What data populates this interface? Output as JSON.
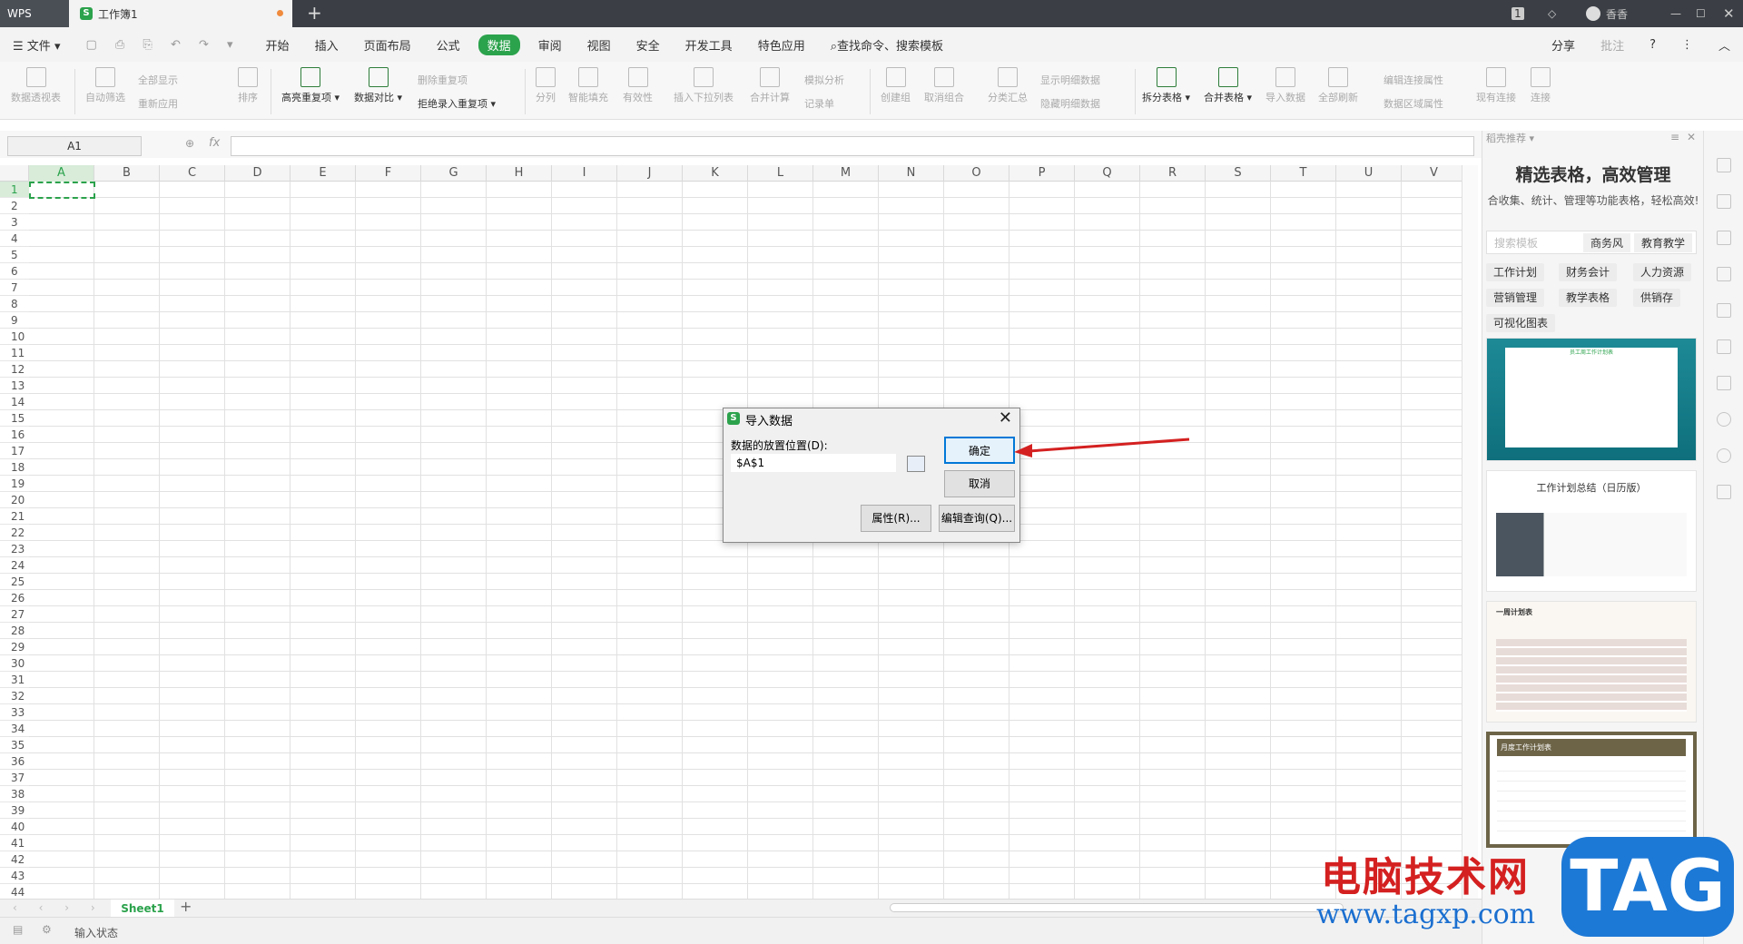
{
  "titlebar": {
    "wps_tab": "WPS",
    "doc_tab": "工作簿1",
    "new_tab": "+",
    "right_user": "香香",
    "right_badge": "1"
  },
  "menubar": {
    "file": "文件",
    "items": [
      "开始",
      "插入",
      "页面布局",
      "公式",
      "数据",
      "审阅",
      "视图",
      "安全",
      "开发工具",
      "特色应用"
    ],
    "active": "数据",
    "search": "查找命令、搜索模板",
    "share": "分享",
    "comment": "批注",
    "help": "?"
  },
  "toolbar": {
    "pivot": "数据透视表",
    "autofilter": "自动筛选",
    "show_all": "全部显示",
    "reapply": "重新应用",
    "sort": "排序",
    "highlight_dup": "高亮重复项",
    "compare": "数据对比",
    "del_dup": "删除重复项",
    "reject_dup": "拒绝录入重复项",
    "split": "分列",
    "smart_fill": "智能填充",
    "validity": "有效性",
    "dropdown": "插入下拉列表",
    "merge_calc": "合并计算",
    "simulate": "模拟分析",
    "record": "记录单",
    "create_group": "创建组",
    "ungroup": "取消组合",
    "subtotal": "分类汇总",
    "show_detail": "显示明细数据",
    "hide_detail": "隐藏明细数据",
    "split_table": "拆分表格",
    "merge_table": "合并表格",
    "import_data": "导入数据",
    "refresh_all": "全部刷新",
    "edit_link": "编辑连接属性",
    "range_attr": "数据区域属性",
    "existing_conn": "现有连接",
    "connect": "连接"
  },
  "formula": {
    "namebox": "A1",
    "fx": "fx"
  },
  "grid": {
    "columns": [
      "A",
      "B",
      "C",
      "D",
      "E",
      "F",
      "G",
      "H",
      "I",
      "J",
      "K",
      "L",
      "M",
      "N",
      "O",
      "P",
      "Q",
      "R",
      "S",
      "T",
      "U",
      "V"
    ],
    "rows": [
      "1",
      "2",
      "3",
      "4",
      "5",
      "6",
      "7",
      "8",
      "9",
      "10",
      "11",
      "12",
      "13",
      "14",
      "15",
      "16",
      "17",
      "18",
      "19",
      "20",
      "21",
      "22",
      "23",
      "24",
      "25",
      "26",
      "27",
      "28",
      "29",
      "30",
      "31",
      "32",
      "33",
      "34",
      "35",
      "36",
      "37",
      "38",
      "39",
      "40",
      "41",
      "42",
      "43",
      "44"
    ]
  },
  "sheetbar": {
    "sheet": "Sheet1",
    "add": "+"
  },
  "status": {
    "text": "输入状态"
  },
  "sidepanel": {
    "header": "稻壳推荐",
    "title": "精选表格，高效管理",
    "subtitle": "合收集、统计、管理等功能表格，轻松高效!",
    "search_placeholder": "搜索模板",
    "tags": [
      "商务风",
      "教育教学"
    ],
    "categories": [
      "工作计划",
      "财务会计",
      "人力资源",
      "营销管理",
      "教学表格",
      "供销存"
    ],
    "viz": "可视化图表",
    "thumbs": [
      "员工周工作计划表",
      "工作计划总结（日历版）",
      "一周计划表",
      "月度工作计划表"
    ]
  },
  "dialog": {
    "title": "导入数据",
    "label": "数据的放置位置(D):",
    "value": "$A$1",
    "ok": "确定",
    "cancel": "取消",
    "props": "属性(R)...",
    "edit_query": "编辑查询(Q)..."
  },
  "watermark": {
    "text": "电脑技术网",
    "url": "www.tagxp.com",
    "tag": "TAG"
  },
  "colors": {
    "accent": "#2ba24c",
    "title_bg": "#3b3f45",
    "dialog_focus": "#0078d7",
    "arrow": "#d42020"
  }
}
